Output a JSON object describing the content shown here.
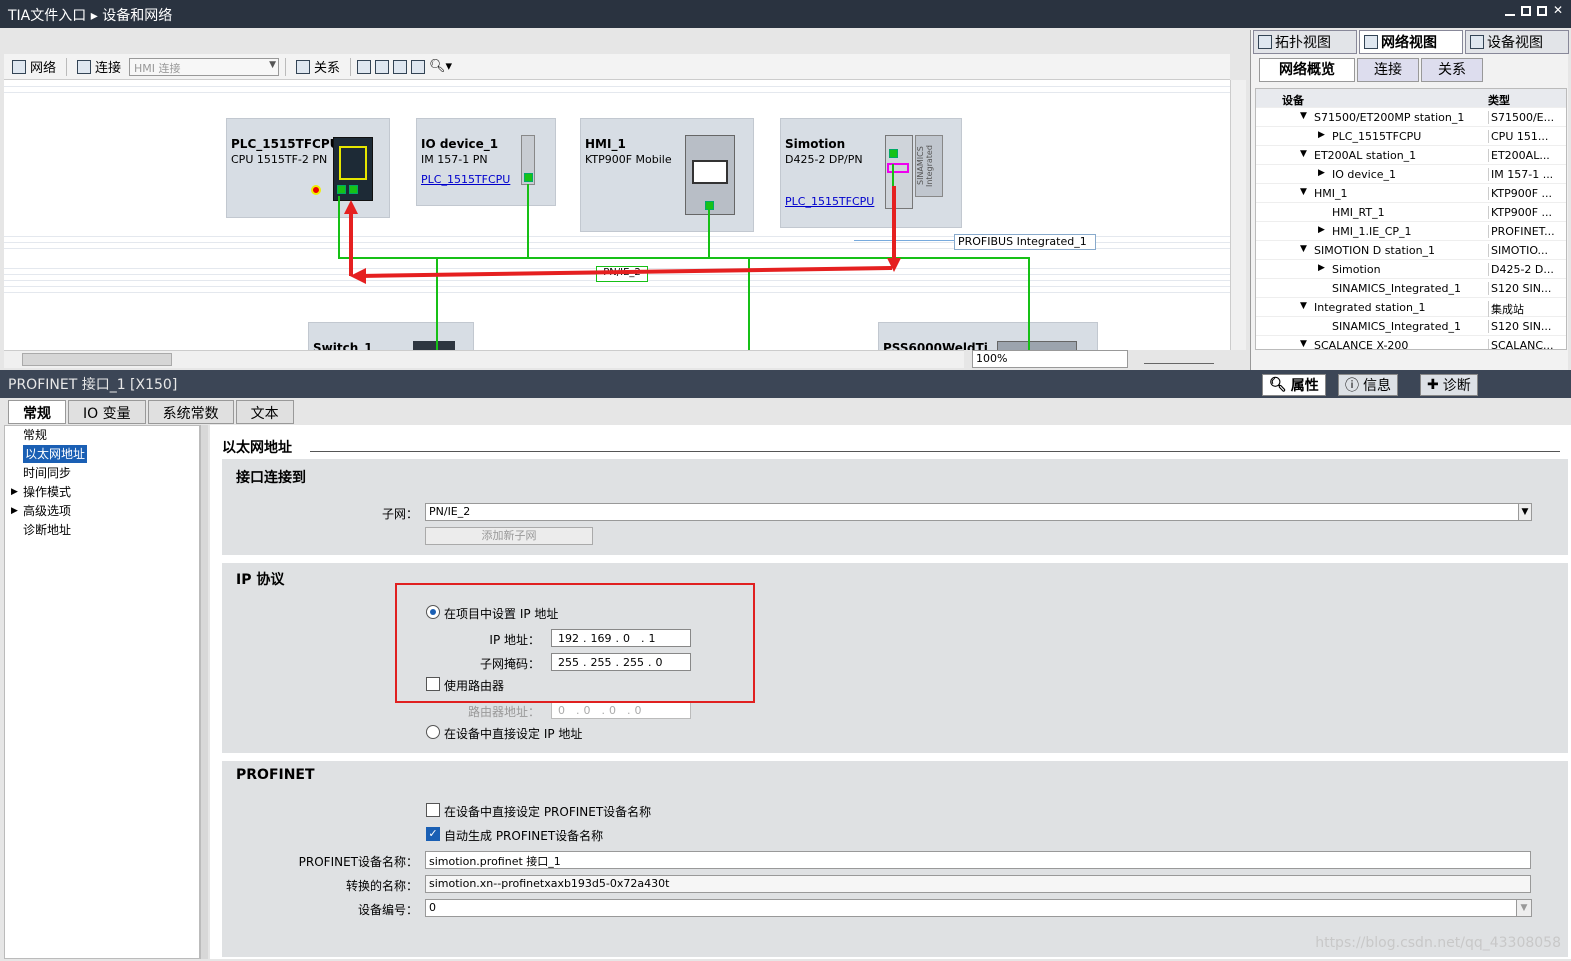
{
  "titlebar": {
    "app": "TIA文件入口",
    "crumb": "设备和网络"
  },
  "view_tabs": [
    "拓扑视图",
    "网络视图",
    "设备视图"
  ],
  "toolbar": {
    "network": "网络",
    "connection": "连接",
    "hmi_select": "HMI 连接",
    "relation": "关系"
  },
  "devices": [
    {
      "name": "PLC_1515TFCPU",
      "sub": "CPU 1515TF-2 PN",
      "link": ""
    },
    {
      "name": "IO device_1",
      "sub": "IM 157-1 PN",
      "link": "PLC_1515TFCPU"
    },
    {
      "name": "HMI_1",
      "sub": "KTP900F Mobile",
      "link": ""
    },
    {
      "name": "Simotion",
      "sub": "D425-2 DP/PN",
      "link": "PLC_1515TFCPU"
    },
    {
      "name": "Switch_1",
      "sub": "",
      "link": ""
    },
    {
      "name": "PSS6000WeldTi",
      "sub": "",
      "link": ""
    }
  ],
  "network_label": "PN/IE_2",
  "profibus_label": "PROFIBUS Integrated_1",
  "sinamics_label": "SINAMICS Integrated",
  "zoom": "100%",
  "overview": {
    "tabs": [
      "网络概览",
      "连接",
      "关系"
    ],
    "col_device": "设备",
    "col_type": "类型",
    "rows": [
      {
        "device": "S71500/ET200MP station_1",
        "type": "S71500/E...",
        "level": 1,
        "exp": "▼"
      },
      {
        "device": "PLC_1515TFCPU",
        "type": "CPU 151...",
        "level": 2,
        "exp": "▶"
      },
      {
        "device": "ET200AL station_1",
        "type": "ET200AL...",
        "level": 1,
        "exp": "▼"
      },
      {
        "device": "IO device_1",
        "type": "IM 157-1 ...",
        "level": 2,
        "exp": "▶"
      },
      {
        "device": "HMI_1",
        "type": "KTP900F ...",
        "level": 1,
        "exp": "▼"
      },
      {
        "device": "HMI_RT_1",
        "type": "KTP900F ...",
        "level": 2,
        "exp": ""
      },
      {
        "device": "HMI_1.IE_CP_1",
        "type": "PROFINET...",
        "level": 2,
        "exp": "▶"
      },
      {
        "device": "SIMOTION D station_1",
        "type": "SIMOTIO...",
        "level": 1,
        "exp": "▼"
      },
      {
        "device": "Simotion",
        "type": "D425-2 D...",
        "level": 2,
        "exp": "▶"
      },
      {
        "device": "SINAMICS_Integrated_1",
        "type": "S120 SIN...",
        "level": 2,
        "exp": ""
      },
      {
        "device": "Integrated station_1",
        "type": "集成站",
        "level": 1,
        "exp": "▼"
      },
      {
        "device": "SINAMICS_Integrated_1",
        "type": "S120 SIN...",
        "level": 2,
        "exp": ""
      },
      {
        "device": "SCALANCE X-200",
        "type": "SCALANC...",
        "level": 1,
        "exp": "▼"
      }
    ]
  },
  "inspector": {
    "title": "PROFINET 接口_1 [X150]",
    "right_tabs": [
      "属性",
      "信息",
      "诊断"
    ],
    "tabs": [
      "常规",
      "IO 变量",
      "系统常数",
      "文本"
    ],
    "nav": [
      {
        "label": "常规",
        "arrow": ""
      },
      {
        "label": "以太网地址",
        "arrow": ""
      },
      {
        "label": "时间同步",
        "arrow": ""
      },
      {
        "label": "操作模式",
        "arrow": "▶"
      },
      {
        "label": "高级选项",
        "arrow": "▶"
      },
      {
        "label": "诊断地址",
        "arrow": ""
      }
    ],
    "heading": "以太网地址"
  },
  "iface": {
    "title": "接口连接到",
    "subnet_label": "子网：",
    "subnet": "PN/IE_2",
    "add_subnet": "添加新子网"
  },
  "ip": {
    "title": "IP 协议",
    "opt_project": "在项目中设置 IP 地址",
    "ip_label": "IP 地址：",
    "ip": [
      "192",
      "169",
      "0",
      "1"
    ],
    "mask_label": "子网掩码：",
    "mask": [
      "255",
      "255",
      "255",
      "0"
    ],
    "router_use": "使用路由器",
    "router_label": "路由器地址：",
    "router": [
      "0",
      "0",
      "0",
      "0"
    ],
    "opt_device": "在设备中直接设定 IP 地址"
  },
  "profinet": {
    "title": "PROFINET",
    "opt_direct": "在设备中直接设定 PROFINET设备名称",
    "opt_auto": "自动生成 PROFINET设备名称",
    "name_label": "PROFINET设备名称：",
    "name": "simotion.profinet 接口_1",
    "conv_label": "转换的名称：",
    "conv": "simotion.xn--profinetxaxb193d5-0x72a430t",
    "num_label": "设备编号：",
    "num": "0"
  },
  "watermark": "https://blog.csdn.net/qq_43308058",
  "colors": {
    "accent": "#1a5fb4",
    "net_line": "#16c016",
    "highlight": "#e02020",
    "titlebar": "#2a3340"
  }
}
